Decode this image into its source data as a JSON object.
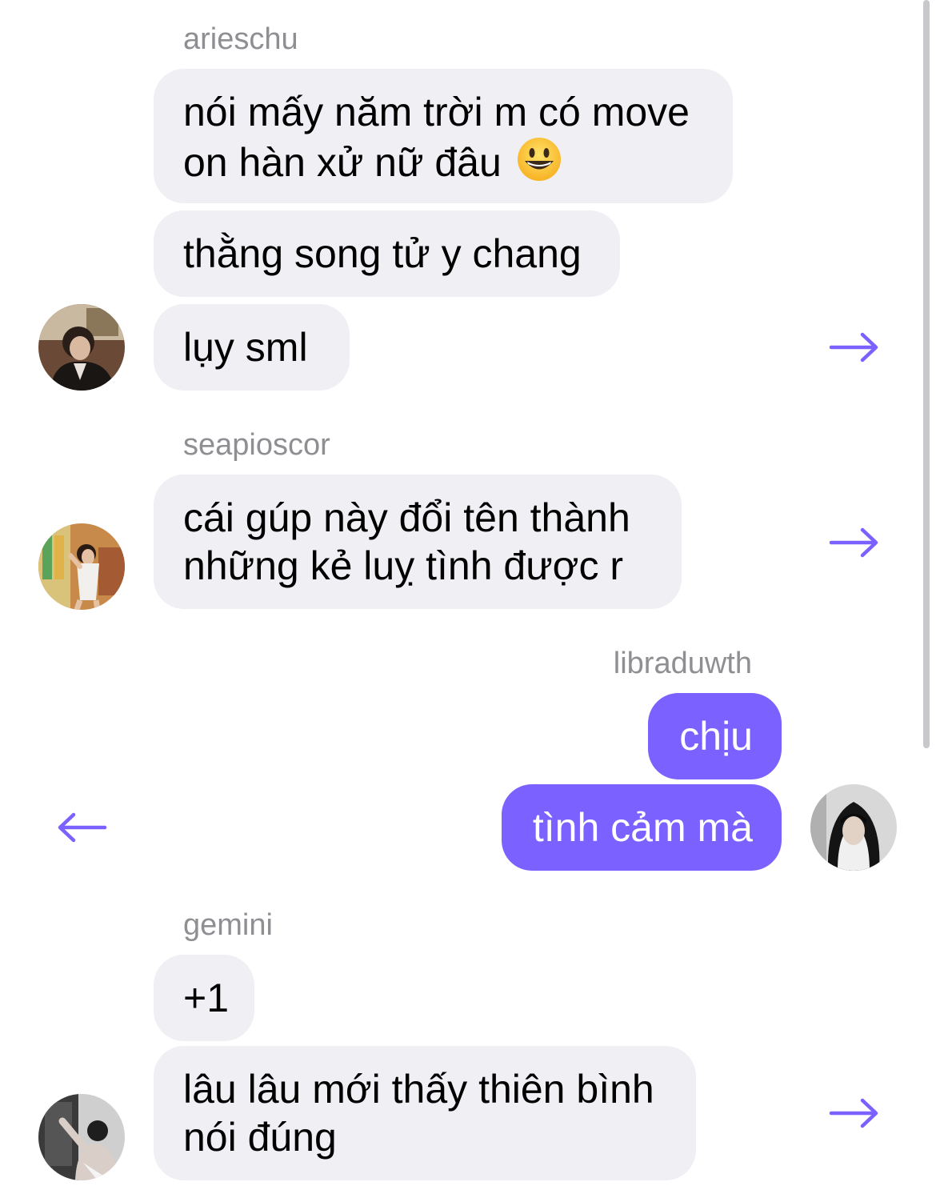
{
  "theme": {
    "accent": "#7b61ff",
    "incoming_bubble": "#efeff4",
    "username_color": "#8e8e93"
  },
  "messages": {
    "group1": {
      "username": "arieschu",
      "bubble1_line1": "nói mấy năm trời m có move",
      "bubble1_line2": "on hàn xử nữ đâu",
      "bubble1_emoji": "grinning-face-emoji",
      "bubble2": "thằng song tử y chang",
      "bubble3": "lụy sml",
      "avatar": "avatar-arieschu",
      "reply_icon": "arrow-right-icon"
    },
    "group2": {
      "username": "seapioscor",
      "bubble1_line1": "cái gúp này đổi tên thành",
      "bubble1_line2": "những kẻ luỵ tình được r",
      "avatar": "avatar-seapioscor",
      "reply_icon": "arrow-right-icon"
    },
    "group3": {
      "username": "libraduwth",
      "bubble1": "chịu",
      "bubble2": "tình cảm mà",
      "avatar": "avatar-libraduwth",
      "reply_icon": "arrow-left-icon"
    },
    "group4": {
      "username": "gemini",
      "bubble1": "+1",
      "bubble2_line1": "lâu lâu mới thấy thiên bình",
      "bubble2_line2": "nói đúng",
      "avatar": "avatar-gemini",
      "reply_icon": "arrow-right-icon"
    }
  }
}
